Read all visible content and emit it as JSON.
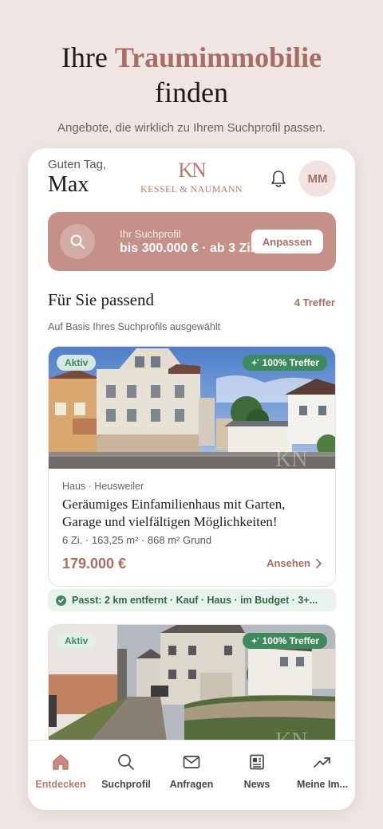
{
  "hero": {
    "title_plain": "Ihre ",
    "title_accent": "Traumimmobilie",
    "title_line2": "finden",
    "subtitle": "Angebote, die wirklich zu Ihrem Suchprofil passen."
  },
  "header": {
    "greeting": "Guten Tag,",
    "username": "Max",
    "logo_mark": "KN",
    "logo_text": "KESSEL & NAUMANN",
    "avatar_initials": "MM"
  },
  "search_profile": {
    "label": "Ihr Suchprofil",
    "value": "bis 300.000 € · ab 3 Zi.",
    "button": "Anpassen"
  },
  "section": {
    "title": "Für Sie passend",
    "count": "4 Treffer",
    "subtitle": "Auf Basis Ihres Suchprofils ausgewählt"
  },
  "listings": [
    {
      "status": "Aktiv",
      "match": "100% Treffer",
      "category": "Haus · Heusweiler",
      "title": "Geräumiges Einfamilienhaus mit Garten, Garage und vielfältigen Möglichkeiten!",
      "meta": "6 Zi.  ·  163,25 m²  ·  868 m² Grund",
      "price": "179.000 €",
      "action": "Ansehen",
      "match_reason": "Passt: 2 km entfernt · Kauf · Haus · im Budget · 3+..."
    },
    {
      "status": "Aktiv",
      "match": "100% Treffer"
    }
  ],
  "tabs": [
    {
      "label": "Entdecken",
      "icon": "home-icon",
      "active": true
    },
    {
      "label": "Suchprofil",
      "icon": "search-icon",
      "active": false
    },
    {
      "label": "Anfragen",
      "icon": "mail-icon",
      "active": false
    },
    {
      "label": "News",
      "icon": "newspaper-icon",
      "active": false
    },
    {
      "label": "Meine Im...",
      "icon": "trending-up-icon",
      "active": false
    }
  ],
  "colors": {
    "background": "#efe5e3",
    "accent": "#a86e63",
    "search_card": "#c59088",
    "success": "#3d8a5c"
  }
}
